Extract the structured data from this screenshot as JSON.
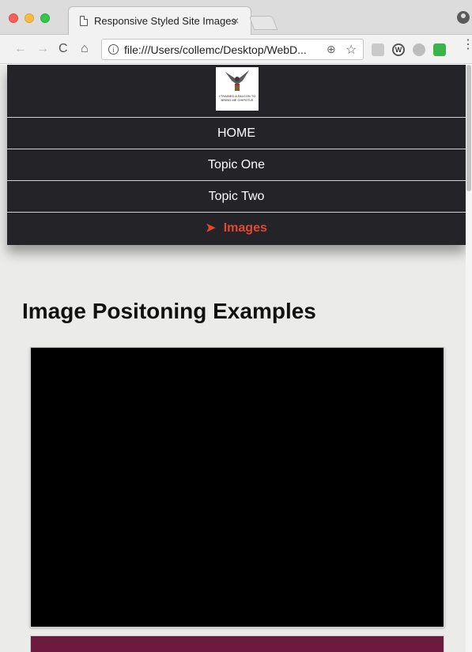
{
  "browser": {
    "tab_title": "Responsive Styled Site Images",
    "tab_close": "×",
    "url": "file:///Users/collemc/Desktop/WebD...",
    "nav_back": "←",
    "nav_forward": "→",
    "nav_reload": "C",
    "nav_home": "⌂",
    "info_glyph": "i",
    "zoom_glyph": "⊕",
    "star_glyph": "☆",
    "extension_w": "W",
    "menu_glyph": "⋮"
  },
  "site": {
    "logo_text": "I TRAINED A FALCON TO BRING ME CHIPOTLE",
    "nav": [
      {
        "label": "HOME"
      },
      {
        "label": "Topic One"
      },
      {
        "label": "Topic Two"
      },
      {
        "label": "Images",
        "active": true,
        "marker": "➤"
      }
    ],
    "active_color": "#e0492e",
    "nav_bg": "#242327",
    "heading": "Image Positoning Examples"
  }
}
